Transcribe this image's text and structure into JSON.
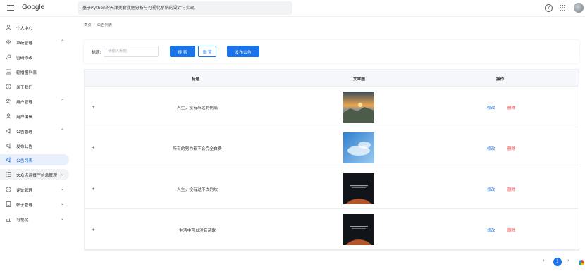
{
  "app": {
    "logo": "Google",
    "search_text": "基于Python的天津美食数据分析与可视化系统的设计与实现",
    "help_glyph": "?"
  },
  "sidebar": {
    "items": [
      {
        "label": "个人中心",
        "icon": "person-icon",
        "expand": ""
      },
      {
        "label": "系统管理",
        "icon": "gear-icon",
        "expand": "up"
      },
      {
        "label": "密码修改",
        "icon": "key-icon",
        "expand": ""
      },
      {
        "label": "轮播图列表",
        "icon": "image-icon",
        "expand": ""
      },
      {
        "label": "关于我们",
        "icon": "info-icon",
        "expand": ""
      },
      {
        "label": "用户管理",
        "icon": "users-icon",
        "expand": "up"
      },
      {
        "label": "用户编辑",
        "icon": "person-icon",
        "expand": ""
      },
      {
        "label": "公告管理",
        "icon": "megaphone-icon",
        "expand": "up"
      },
      {
        "label": "发布公告",
        "icon": "megaphone-icon",
        "expand": ""
      },
      {
        "label": "公告列表",
        "icon": "megaphone-icon",
        "expand": "",
        "active": true
      },
      {
        "label": "大众点评餐厅信息管理",
        "icon": "list-icon",
        "expand": "down",
        "hover": true
      },
      {
        "label": "评论管理",
        "icon": "comment-icon",
        "expand": "down"
      },
      {
        "label": "帖子管理",
        "icon": "document-icon",
        "expand": "down"
      },
      {
        "label": "可视化",
        "icon": "chart-icon",
        "expand": "down"
      }
    ]
  },
  "breadcrumb": {
    "home": "首页",
    "separator": "/",
    "current": "公告列表"
  },
  "filter": {
    "label": "标题:",
    "placeholder": "请输入标题",
    "search_button": "搜 索",
    "reset_button": "重 置",
    "publish_button": "发布公告"
  },
  "table": {
    "headers": {
      "title": "标题",
      "image": "文章图",
      "actions": "操作"
    },
    "expand_glyph": "+",
    "edit_label": "修改",
    "delete_label": "删除",
    "rows": [
      {
        "title": "人生，没有永远的伤痛",
        "image": "sunset-mountain"
      },
      {
        "title": "所有的努力都不会完全白费",
        "image": "blue-sky-clouds"
      },
      {
        "title": "人生，没有过不去的坎",
        "image": "dark-planet-poster"
      },
      {
        "title": "生活中可以没有诗歌",
        "image": "dark-planet-poster"
      }
    ]
  },
  "pagination": {
    "prev": "‹",
    "current": "1",
    "next": "›"
  },
  "colors": {
    "accent": "#1a73e8",
    "danger": "#e53935",
    "active_bg": "#e8f0fe"
  }
}
